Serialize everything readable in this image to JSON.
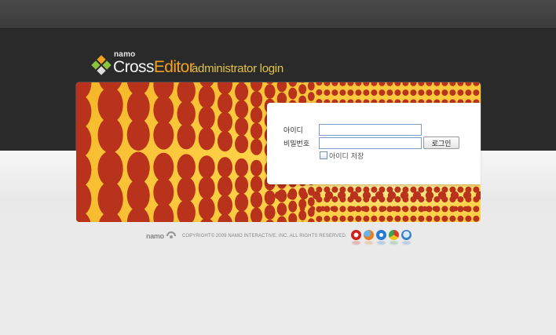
{
  "header": {
    "brand_small": "namo",
    "product_prefix": "Cross",
    "product_accent": "Editor",
    "subtitle": "administrator login"
  },
  "login": {
    "id_label": "아이디",
    "password_label": "비밀번호",
    "id_value": "",
    "password_value": "",
    "login_button": "로그인",
    "remember_label": "아이디 저장",
    "remember_checked": false
  },
  "footer": {
    "brand": "namo",
    "copyright": "COPYRIGHT© 2009 NAMO INTERACTIVE, INC. ALL RIGHTS RESERVED.",
    "browser_icons": [
      "opera-icon",
      "firefox-icon",
      "internet-explorer-icon",
      "chrome-icon",
      "safari-icon"
    ]
  },
  "colors": {
    "accent_orange": "#f2a120",
    "subtitle_gold": "#e3c24a",
    "banner_dot": "#b8321c",
    "banner_yellow": "#ffd34a",
    "input_border": "#7a9cc6"
  }
}
